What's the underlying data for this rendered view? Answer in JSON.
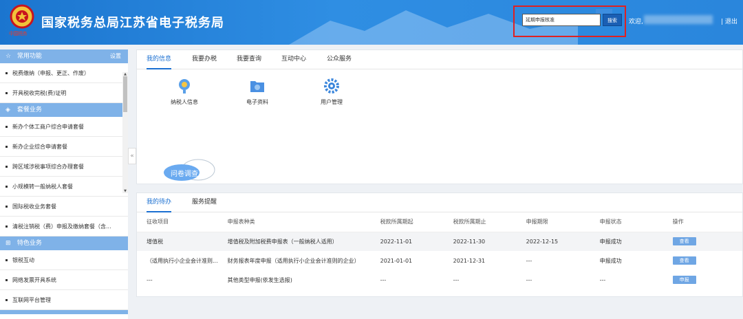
{
  "header": {
    "title": "国家税务总局江苏省电子税务局",
    "emblem_caption": "中国税务",
    "search_value": "延期申报核准",
    "search_button": "搜索",
    "welcome": "欢迎,",
    "logout": "| 退出"
  },
  "sidebar": {
    "sections": [
      {
        "icon": "star-icon",
        "glyph": "☆",
        "label": "常用功能",
        "settings": "设置",
        "items": [
          "税费缴纳（申报、更正、作废）",
          "开具税收完税(费)证明"
        ]
      },
      {
        "icon": "package-icon",
        "glyph": "◈",
        "label": "套餐业务",
        "items": [
          "新办个体工商户综合申请套餐",
          "新办企业综合申请套餐",
          "跨区域涉税事项综合办理套餐",
          "小规模转一般纳税人套餐",
          "国际税收业务套餐",
          "清税注销税（费）申报及缴纳套餐（含..."
        ]
      },
      {
        "icon": "grid-icon",
        "glyph": "⊞",
        "label": "特色业务",
        "items": [
          "银税互动",
          "网络发票开具系统",
          "互联网平台管理"
        ]
      }
    ]
  },
  "main": {
    "tabs": [
      "我的信息",
      "我要办税",
      "我要查询",
      "互动中心",
      "公众服务"
    ],
    "active_tab": 0,
    "quick": [
      {
        "icon": "taxpayer-info-icon",
        "label": "纳税人信息"
      },
      {
        "icon": "e-documents-icon",
        "label": "电子资料"
      },
      {
        "icon": "user-management-icon",
        "label": "用户管理"
      }
    ],
    "survey": "问卷调查"
  },
  "todo": {
    "tabs": [
      "我的待办",
      "服务提醒"
    ],
    "columns": [
      "征收项目",
      "申报表种类",
      "税款所属期起",
      "税款所属期止",
      "申报期限",
      "申报状态",
      "操作"
    ],
    "rows": [
      [
        "增值税",
        "增值税及附加税费申报表（一般纳税人适用）",
        "2022-11-01",
        "2022-11-30",
        "2022-12-15",
        "申报成功",
        "查看"
      ],
      [
        "（适用执行小企业会计准则...",
        "财务报表年度申报（适用执行小企业会计准则的企业）",
        "2021-01-01",
        "2021-12-31",
        "---",
        "申报成功",
        "查看"
      ],
      [
        "---",
        "其他类型申报(依发生选报)",
        "---",
        "---",
        "---",
        "---",
        "申报"
      ]
    ]
  },
  "colors": {
    "header_blue": "#2a86dc",
    "accent": "#1a6fd1",
    "sidebar_section": "#7fb2e8",
    "highlight_red": "#e02020"
  }
}
